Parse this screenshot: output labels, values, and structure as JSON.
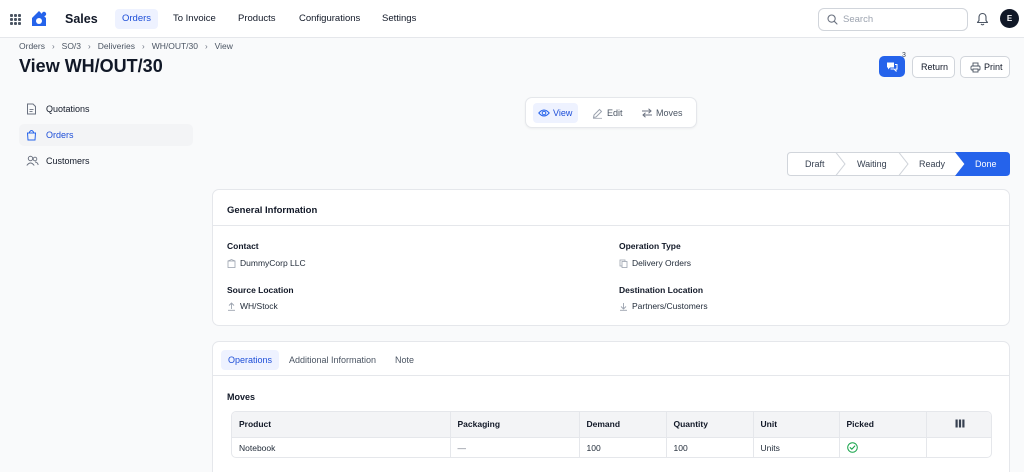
{
  "app": {
    "title": "Sales",
    "nav": [
      {
        "label": "Orders",
        "active": true
      },
      {
        "label": "To Invoice",
        "active": false
      },
      {
        "label": "Products",
        "active": false
      },
      {
        "label": "Configurations",
        "active": false
      },
      {
        "label": "Settings",
        "active": false
      }
    ],
    "search_placeholder": "Search",
    "avatar_initial": "E",
    "accent_color": "#2563eb"
  },
  "breadcrumb": [
    "Orders",
    "SO/3",
    "Deliveries",
    "WH/OUT/30",
    "View"
  ],
  "page_title": "View WH/OUT/30",
  "actions": {
    "chatter_count": "3",
    "return_label": "Return",
    "print_label": "Print"
  },
  "sidebar": {
    "items": [
      {
        "label": "Quotations",
        "icon": "document-icon",
        "active": false
      },
      {
        "label": "Orders",
        "icon": "shopping-bag-icon",
        "active": true
      },
      {
        "label": "Customers",
        "icon": "users-icon",
        "active": false
      }
    ]
  },
  "view_toggle": {
    "view": "View",
    "edit": "Edit",
    "moves": "Moves",
    "active": "View"
  },
  "stepper": {
    "steps": [
      "Draft",
      "Waiting",
      "Ready",
      "Done"
    ],
    "current": "Done"
  },
  "general": {
    "title": "General Information",
    "contact_label": "Contact",
    "contact_value": "DummyCorp LLC",
    "operation_type_label": "Operation Type",
    "operation_type_value": "Delivery Orders",
    "source_label": "Source Location",
    "source_value": "WH/Stock",
    "destination_label": "Destination Location",
    "destination_value": "Partners/Customers"
  },
  "tabs": {
    "items": [
      "Operations",
      "Additional Information",
      "Note"
    ],
    "active": "Operations"
  },
  "moves": {
    "title": "Moves",
    "columns": [
      "Product",
      "Packaging",
      "Demand",
      "Quantity",
      "Unit",
      "Picked"
    ],
    "rows": [
      {
        "product": "Notebook",
        "packaging": "—",
        "demand": "100",
        "quantity": "100",
        "unit": "Units",
        "picked": true
      }
    ]
  }
}
